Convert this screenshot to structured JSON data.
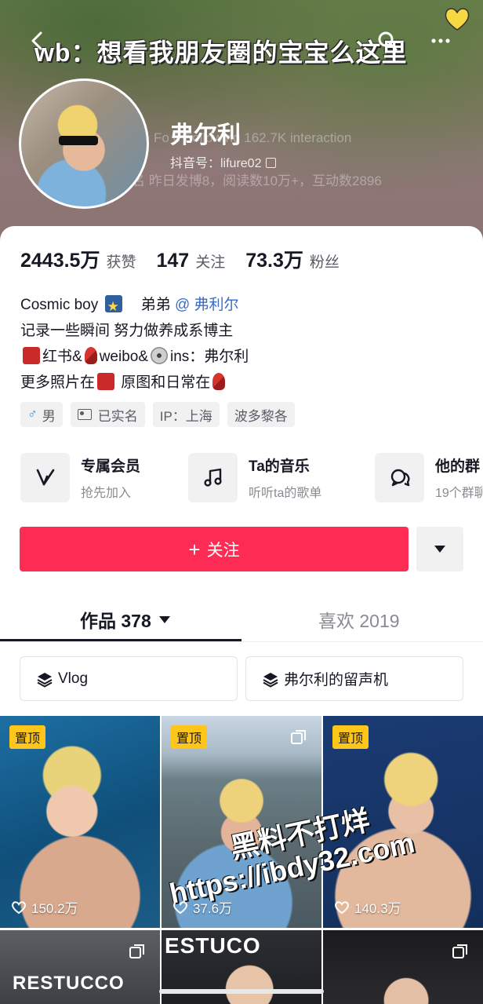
{
  "cover": {
    "overlay_text": "wb：想看我朋友圈的宝宝么这里",
    "ghost_stats": "Fo    6 Following      162.7K interaction",
    "ghost_row": "名       昨日发博8，阅读数10万+，互动数2896"
  },
  "profile": {
    "name": "弗尔利",
    "douyin_id": "抖音号：lifure02"
  },
  "stats": [
    {
      "value": "2443.5万",
      "label": "获赞"
    },
    {
      "value": "147",
      "label": "关注"
    },
    {
      "value": "73.3万",
      "label": "粉丝"
    }
  ],
  "bio": {
    "line1_a": "Cosmic boy",
    "line1_b": "弟弟",
    "line1_link": "@ 弗利尔",
    "line2": "记录一些瞬间 努力做养成系博主",
    "line3_a": "红书&",
    "line3_b": "weibo&",
    "line3_c": "ins：弗尔利",
    "line4_a": "更多照片在",
    "line4_b": "原图和日常在"
  },
  "tags": {
    "gender": "男",
    "verified": "已实名",
    "ip": "IP：上海",
    "location": "波多黎各"
  },
  "features": [
    {
      "title": "专属会员",
      "sub": "抢先加入",
      "icon": "v-icon"
    },
    {
      "title": "Ta的音乐",
      "sub": "听听ta的歌单",
      "icon": "music-note-icon"
    },
    {
      "title": "他的群",
      "sub": "19个群聊",
      "icon": "chat-bubbles-icon"
    }
  ],
  "actions": {
    "follow_plus": "+",
    "follow_label": "关注"
  },
  "tabs": {
    "works_label": "作品 378",
    "likes_label": "喜欢 2019"
  },
  "collections": [
    {
      "label": "Vlog"
    },
    {
      "label": "弗尔利的留声机"
    }
  ],
  "videos": [
    {
      "pinned": "置顶",
      "likes": "150.2万"
    },
    {
      "pinned": "置顶",
      "likes": "37.6万"
    },
    {
      "pinned": "置顶",
      "likes": "140.3万"
    },
    {
      "pinned": "",
      "likes": "",
      "sign": "RESTUCCO"
    },
    {
      "pinned": "",
      "likes": "",
      "sign": "ESTUCO"
    },
    {
      "pinned": "",
      "likes": ""
    }
  ],
  "watermark": {
    "line1": "黑料不打烊",
    "line2": "https://ibdy32.com"
  },
  "colors": {
    "accent": "#fe2c55",
    "pin": "#fec51b",
    "link": "#3a6cc8"
  }
}
